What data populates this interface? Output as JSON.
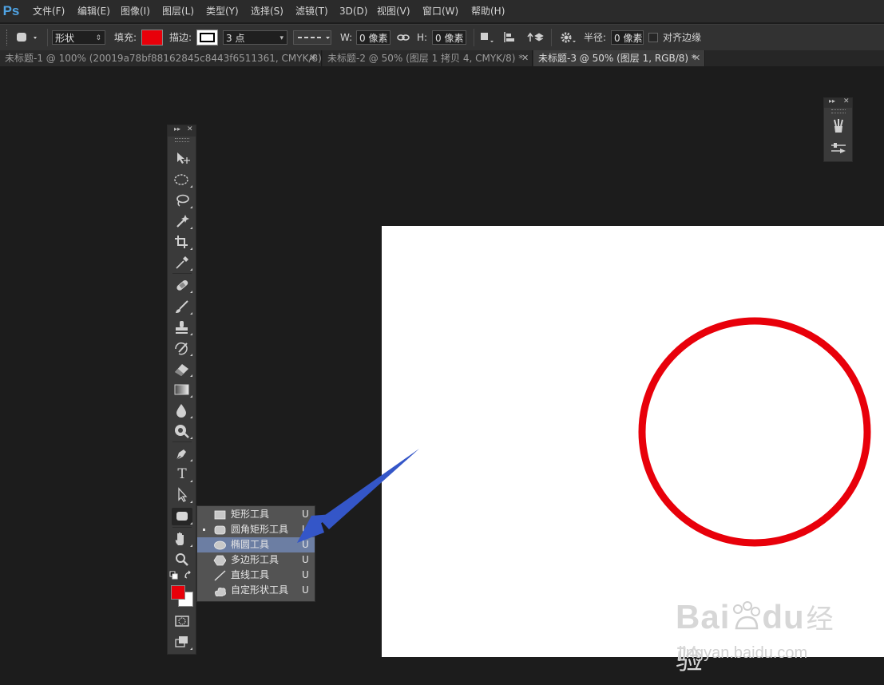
{
  "app": {
    "logo": "Ps"
  },
  "menu": [
    "文件(F)",
    "编辑(E)",
    "图像(I)",
    "图层(L)",
    "类型(Y)",
    "选择(S)",
    "滤镜(T)",
    "3D(D)",
    "视图(V)",
    "窗口(W)",
    "帮助(H)"
  ],
  "options": {
    "mode_value": "形状",
    "fill_label": "填充:",
    "fill_color": "#e8000a",
    "stroke_label": "描边:",
    "stroke_width": "3 点",
    "w_label": "W:",
    "w_value": "0 像素",
    "h_label": "H:",
    "h_value": "0 像素",
    "radius_label": "半径:",
    "radius_value": "0 像素",
    "align_edges_label": "对齐边缘"
  },
  "tabs": [
    {
      "label": "未标题-1 @ 100% (20019a78bf88162845c8443f6511361, CMYK/8) *",
      "active": false
    },
    {
      "label": "未标题-2 @ 50% (图层 1 拷贝 4, CMYK/8) *",
      "active": false
    },
    {
      "label": "未标题-3 @ 50% (图层 1, RGB/8) *",
      "active": true
    }
  ],
  "tools": [
    "move-tool",
    "elliptical-marquee-tool",
    "lasso-tool",
    "magic-wand-tool",
    "crop-tool",
    "eyedropper-tool",
    "healing-brush-tool",
    "brush-tool",
    "clone-stamp-tool",
    "history-brush-tool",
    "eraser-tool",
    "gradient-tool",
    "blur-tool",
    "dodge-tool",
    "pen-tool",
    "type-tool",
    "path-selection-tool",
    "rounded-rectangle-tool",
    "hand-tool",
    "zoom-tool"
  ],
  "type_tool_glyph": "T",
  "flyout": {
    "items": [
      {
        "label": "矩形工具",
        "key": "U",
        "icon": "rectangle-icon"
      },
      {
        "label": "圆角矩形工具",
        "key": "U",
        "icon": "rounded-rectangle-icon",
        "current": true
      },
      {
        "label": "椭圆工具",
        "key": "U",
        "icon": "ellipse-icon",
        "highlighted": true
      },
      {
        "label": "多边形工具",
        "key": "U",
        "icon": "polygon-icon"
      },
      {
        "label": "直线工具",
        "key": "U",
        "icon": "line-icon"
      },
      {
        "label": "自定形状工具",
        "key": "U",
        "icon": "custom-shape-icon"
      }
    ]
  },
  "colors": {
    "foreground": "#e8000a",
    "background": "#ffffff",
    "circle_stroke": "#e8000a",
    "arrow": "#3456c8"
  },
  "watermark": {
    "brand": "Bai",
    "brand2": "du",
    "cn": "经验",
    "url": "jingyan.baidu.com"
  }
}
